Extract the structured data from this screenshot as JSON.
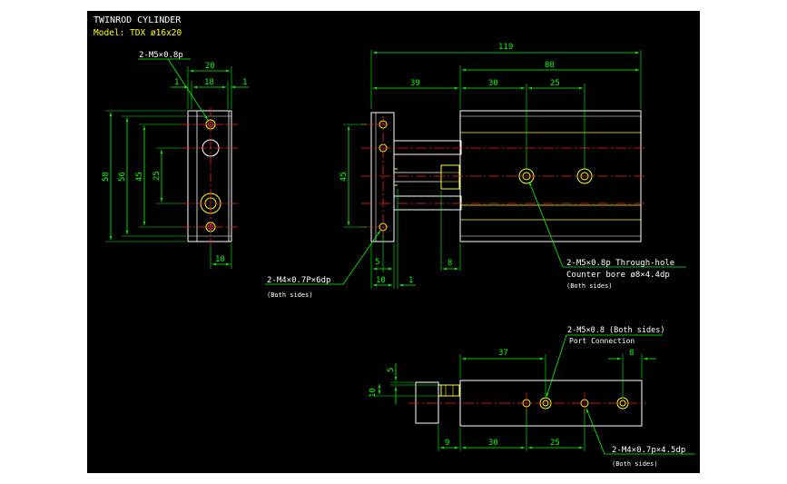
{
  "title": {
    "line1": "TWINROD CYLINDER",
    "line2": "Model: TDX ø16x20"
  },
  "side_view": {
    "callout_top": "2-M5×0.8p",
    "dim_20": "20",
    "dim_1a": "1",
    "dim_18": "18",
    "dim_1b": "1",
    "dim_58": "58",
    "dim_56": "56",
    "dim_45": "45",
    "dim_25": "25",
    "dim_10": "10"
  },
  "front_view": {
    "dim_119": "119",
    "dim_80": "80",
    "dim_39": "39",
    "dim_30": "30",
    "dim_25": "25",
    "dim_45": "45",
    "dim_5": "5",
    "dim_8": "8",
    "dim_10": "10",
    "dim_1": "1",
    "callout_left": "2-M4×0.7P×6dp",
    "callout_left_sub": "(Both sides)",
    "callout_right_1": "2-M5×0.8p Through-hole",
    "callout_right_2": "Counter bore ø8×4.4dp",
    "callout_right_sub": "(Both sides)"
  },
  "bottom_view": {
    "callout_top": "2-M5×0.8 (Both sides)",
    "callout_top_sub": "Port Connection",
    "dim_37": "37",
    "dim_8": "8",
    "dim_5": "5",
    "dim_10": "10",
    "dim_9": "9",
    "dim_30": "30",
    "dim_25": "25",
    "callout_bottom": "2-M4×0.7p×4.5dp",
    "callout_bottom_sub": "(Both sides)"
  },
  "colors": {
    "background": "#000000",
    "outline": "#ffffff",
    "dimension": "#00ff00",
    "centerline": "#ff2020",
    "holes": "#ffff00",
    "text": "#ffffff"
  }
}
